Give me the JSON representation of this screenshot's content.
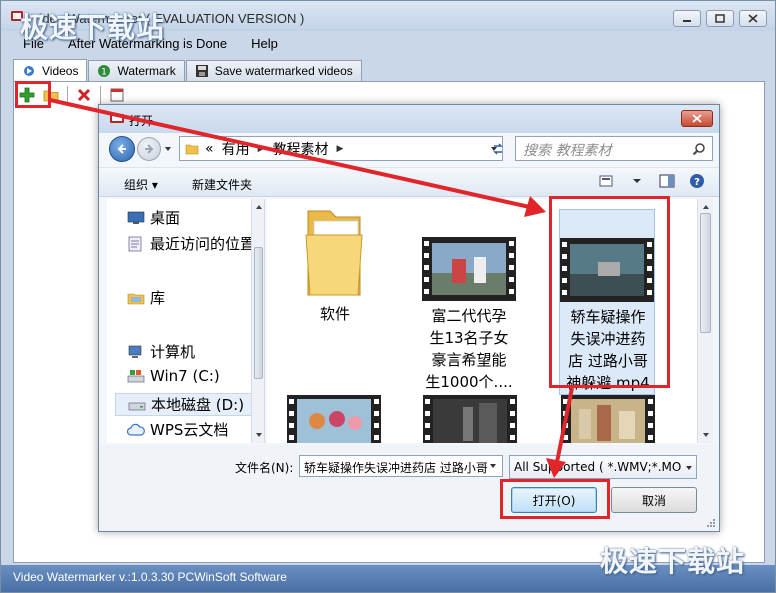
{
  "app": {
    "title": "Video Watermarker ( EVALUATION VERSION )",
    "menu": [
      "File",
      "After Watermarking is Done",
      "Help"
    ],
    "tabs": [
      "Videos",
      "Watermark",
      "Save watermarked videos"
    ],
    "status": "Video Watermarker v.:1.0.3.30 PCWinSoft Software"
  },
  "dialog": {
    "title": "打开",
    "address": [
      "«",
      "有用",
      "教程素材"
    ],
    "search_placeholder": "搜索 教程素材",
    "commands": {
      "organize": "组织 ▾",
      "new_folder": "新建文件夹"
    },
    "nav_items": [
      {
        "label": "桌面",
        "icon": "desktop-icon"
      },
      {
        "label": "最近访问的位置",
        "icon": "recent-places-icon"
      },
      {
        "label": "库",
        "icon": "libraries-icon"
      },
      {
        "label": "计算机",
        "icon": "computer-icon"
      },
      {
        "label": "Win7 (C:)",
        "icon": "system-drive-icon"
      },
      {
        "label": "本地磁盘 (D:)",
        "icon": "hard-drive-icon"
      },
      {
        "label": "WPS云文档",
        "icon": "cloud-icon"
      }
    ],
    "files": [
      {
        "lines": [
          "软件"
        ],
        "type": "folder"
      },
      {
        "lines": [
          "富二代代孕",
          "生13名子女",
          "豪言希望能",
          "生1000个...."
        ],
        "type": "video"
      },
      {
        "lines": [
          "轿车疑操作",
          "失误冲进药",
          "店 过路小哥",
          "神躲避.mp4"
        ],
        "type": "video",
        "selected": true
      }
    ],
    "filename_label": "文件名(N):",
    "filename_value": "轿车疑操作失误冲进药店 过路小哥",
    "filter": "All Supported ( *.WMV;*.MO",
    "open_button": "打开(O)",
    "cancel_button": "取消"
  },
  "watermarks": {
    "top": "极速下载站",
    "bottom": "极速下载站"
  },
  "colors": {
    "highlight": "#e1262b",
    "statusbar": "#4f74aa",
    "selection": "#dbe9f8"
  }
}
